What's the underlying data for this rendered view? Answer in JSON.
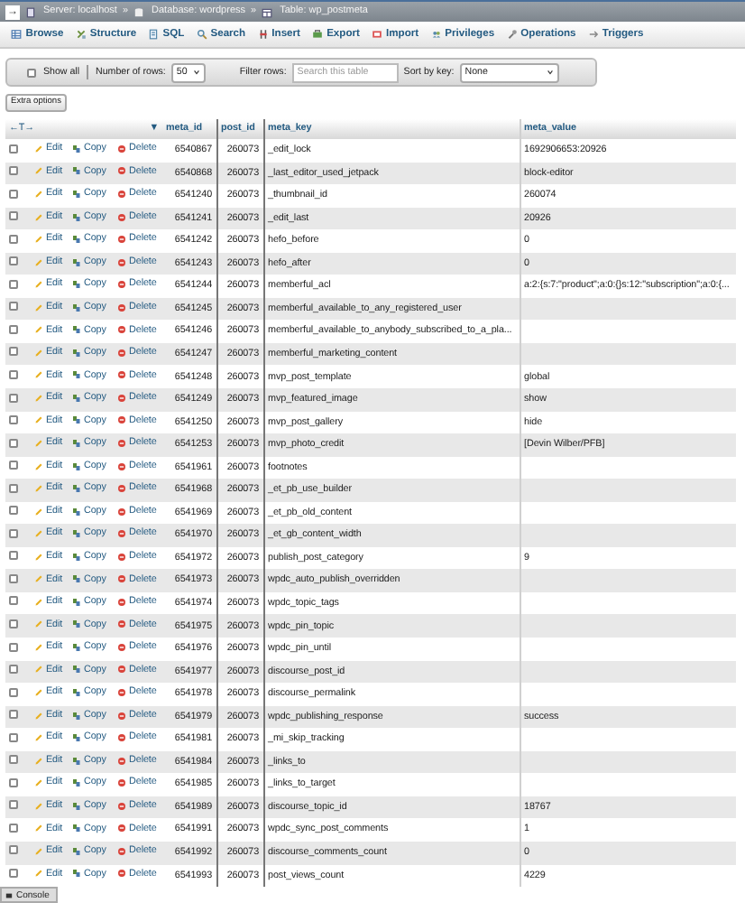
{
  "breadcrumb": {
    "toggle": "→",
    "items": [
      {
        "kind": "server",
        "label": "Server: localhost"
      },
      {
        "kind": "separator",
        "label": "»"
      },
      {
        "kind": "database",
        "label": "Database: wordpress"
      },
      {
        "kind": "separator",
        "label": "»"
      },
      {
        "kind": "table",
        "label": "Table: wp_postmeta"
      }
    ]
  },
  "tabs": [
    {
      "label": "Browse",
      "selected": false
    },
    {
      "label": "Structure",
      "selected": false
    },
    {
      "label": "SQL",
      "selected": false
    },
    {
      "label": "Search",
      "selected": false
    },
    {
      "label": "Insert",
      "selected": false
    },
    {
      "label": "Export",
      "selected": false
    },
    {
      "label": "Import",
      "selected": false
    },
    {
      "label": "Privileges",
      "selected": false
    },
    {
      "label": "Operations",
      "selected": false
    },
    {
      "label": "Triggers",
      "selected": false
    }
  ],
  "options": {
    "show_all": {
      "label": "Show all",
      "checked": false
    },
    "rows_label": "Number of rows:",
    "rows_value": "50",
    "filter_label": "Filter rows:",
    "filter_placeholder": "Search this table",
    "sort_label": "Sort by key:",
    "sort_value": "None"
  },
  "extra_options": "Extra options",
  "table": {
    "arrows": "←T→",
    "menu": "▼",
    "columns": [
      "meta_id",
      "post_id",
      "meta_key",
      "meta_value"
    ],
    "rows": [
      {
        "checked": false,
        "actions": [
          "Edit",
          "Copy",
          "Delete"
        ],
        "cells": [
          "6540867",
          "260073",
          "_edit_lock",
          "1692906653:20926"
        ]
      },
      {
        "checked": false,
        "actions": [
          "Edit",
          "Copy",
          "Delete"
        ],
        "cells": [
          "6540868",
          "260073",
          "_last_editor_used_jetpack",
          "block-editor"
        ]
      },
      {
        "checked": false,
        "actions": [
          "Edit",
          "Copy",
          "Delete"
        ],
        "cells": [
          "6541240",
          "260073",
          "_thumbnail_id",
          "260074"
        ]
      },
      {
        "checked": false,
        "actions": [
          "Edit",
          "Copy",
          "Delete"
        ],
        "cells": [
          "6541241",
          "260073",
          "_edit_last",
          "20926"
        ]
      },
      {
        "checked": false,
        "actions": [
          "Edit",
          "Copy",
          "Delete"
        ],
        "cells": [
          "6541242",
          "260073",
          "hefo_before",
          "0"
        ]
      },
      {
        "checked": false,
        "actions": [
          "Edit",
          "Copy",
          "Delete"
        ],
        "cells": [
          "6541243",
          "260073",
          "hefo_after",
          "0"
        ]
      },
      {
        "checked": false,
        "actions": [
          "Edit",
          "Copy",
          "Delete"
        ],
        "cells": [
          "6541244",
          "260073",
          "memberful_acl",
          "a:2:{s:7:\"product\";a:0:{}s:12:\"subscription\";a:0:{..."
        ]
      },
      {
        "checked": false,
        "actions": [
          "Edit",
          "Copy",
          "Delete"
        ],
        "cells": [
          "6541245",
          "260073",
          "memberful_available_to_any_registered_user",
          ""
        ]
      },
      {
        "checked": false,
        "actions": [
          "Edit",
          "Copy",
          "Delete"
        ],
        "cells": [
          "6541246",
          "260073",
          "memberful_available_to_anybody_subscribed_to_a_pla...",
          ""
        ]
      },
      {
        "checked": false,
        "actions": [
          "Edit",
          "Copy",
          "Delete"
        ],
        "cells": [
          "6541247",
          "260073",
          "memberful_marketing_content",
          ""
        ]
      },
      {
        "checked": false,
        "actions": [
          "Edit",
          "Copy",
          "Delete"
        ],
        "cells": [
          "6541248",
          "260073",
          "mvp_post_template",
          "global"
        ]
      },
      {
        "checked": false,
        "actions": [
          "Edit",
          "Copy",
          "Delete"
        ],
        "cells": [
          "6541249",
          "260073",
          "mvp_featured_image",
          "show"
        ]
      },
      {
        "checked": false,
        "actions": [
          "Edit",
          "Copy",
          "Delete"
        ],
        "cells": [
          "6541250",
          "260073",
          "mvp_post_gallery",
          "hide"
        ]
      },
      {
        "checked": false,
        "actions": [
          "Edit",
          "Copy",
          "Delete"
        ],
        "cells": [
          "6541253",
          "260073",
          "mvp_photo_credit",
          "[Devin Wilber/PFB]"
        ]
      },
      {
        "checked": false,
        "actions": [
          "Edit",
          "Copy",
          "Delete"
        ],
        "cells": [
          "6541961",
          "260073",
          "footnotes",
          ""
        ]
      },
      {
        "checked": false,
        "actions": [
          "Edit",
          "Copy",
          "Delete"
        ],
        "cells": [
          "6541968",
          "260073",
          "_et_pb_use_builder",
          ""
        ]
      },
      {
        "checked": false,
        "actions": [
          "Edit",
          "Copy",
          "Delete"
        ],
        "cells": [
          "6541969",
          "260073",
          "_et_pb_old_content",
          ""
        ]
      },
      {
        "checked": false,
        "actions": [
          "Edit",
          "Copy",
          "Delete"
        ],
        "cells": [
          "6541970",
          "260073",
          "_et_gb_content_width",
          ""
        ]
      },
      {
        "checked": false,
        "actions": [
          "Edit",
          "Copy",
          "Delete"
        ],
        "cells": [
          "6541972",
          "260073",
          "publish_post_category",
          "9"
        ]
      },
      {
        "checked": false,
        "actions": [
          "Edit",
          "Copy",
          "Delete"
        ],
        "cells": [
          "6541973",
          "260073",
          "wpdc_auto_publish_overridden",
          ""
        ]
      },
      {
        "checked": false,
        "actions": [
          "Edit",
          "Copy",
          "Delete"
        ],
        "cells": [
          "6541974",
          "260073",
          "wpdc_topic_tags",
          ""
        ]
      },
      {
        "checked": false,
        "actions": [
          "Edit",
          "Copy",
          "Delete"
        ],
        "cells": [
          "6541975",
          "260073",
          "wpdc_pin_topic",
          ""
        ]
      },
      {
        "checked": false,
        "actions": [
          "Edit",
          "Copy",
          "Delete"
        ],
        "cells": [
          "6541976",
          "260073",
          "wpdc_pin_until",
          ""
        ]
      },
      {
        "checked": false,
        "actions": [
          "Edit",
          "Copy",
          "Delete"
        ],
        "cells": [
          "6541977",
          "260073",
          "discourse_post_id",
          ""
        ]
      },
      {
        "checked": false,
        "actions": [
          "Edit",
          "Copy",
          "Delete"
        ],
        "cells": [
          "6541978",
          "260073",
          "discourse_permalink",
          ""
        ]
      },
      {
        "checked": false,
        "actions": [
          "Edit",
          "Copy",
          "Delete"
        ],
        "cells": [
          "6541979",
          "260073",
          "wpdc_publishing_response",
          "success"
        ]
      },
      {
        "checked": false,
        "actions": [
          "Edit",
          "Copy",
          "Delete"
        ],
        "cells": [
          "6541981",
          "260073",
          "_mi_skip_tracking",
          ""
        ]
      },
      {
        "checked": false,
        "actions": [
          "Edit",
          "Copy",
          "Delete"
        ],
        "cells": [
          "6541984",
          "260073",
          "_links_to",
          ""
        ]
      },
      {
        "checked": false,
        "actions": [
          "Edit",
          "Copy",
          "Delete"
        ],
        "cells": [
          "6541985",
          "260073",
          "_links_to_target",
          ""
        ]
      },
      {
        "checked": false,
        "actions": [
          "Edit",
          "Copy",
          "Delete"
        ],
        "cells": [
          "6541989",
          "260073",
          "discourse_topic_id",
          "18767"
        ]
      },
      {
        "checked": false,
        "actions": [
          "Edit",
          "Copy",
          "Delete"
        ],
        "cells": [
          "6541991",
          "260073",
          "wpdc_sync_post_comments",
          "1"
        ]
      },
      {
        "checked": false,
        "actions": [
          "Edit",
          "Copy",
          "Delete"
        ],
        "cells": [
          "6541992",
          "260073",
          "discourse_comments_count",
          "0"
        ]
      },
      {
        "checked": false,
        "actions": [
          "Edit",
          "Copy",
          "Delete"
        ],
        "cells": [
          "6541993",
          "260073",
          "post_views_count",
          "4229"
        ]
      }
    ]
  },
  "console": "Console"
}
